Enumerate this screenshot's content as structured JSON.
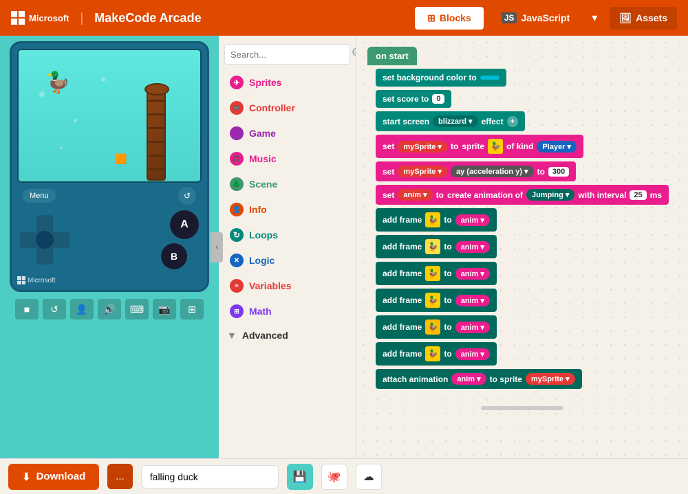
{
  "header": {
    "brand": "MakeCode Arcade",
    "ms_label": "Microsoft",
    "tab_blocks": "Blocks",
    "tab_javascript": "JavaScript",
    "tab_assets": "Assets"
  },
  "simulator": {
    "menu_label": "Menu",
    "ms_device_label": "Microsoft",
    "buttons": {
      "a": "A",
      "b": "B"
    }
  },
  "sim_toolbar": {
    "buttons": [
      "■",
      "↺",
      "👤",
      "🔊",
      "⌨",
      "📷",
      "⊞"
    ]
  },
  "categories": {
    "search_placeholder": "Search...",
    "items": [
      {
        "id": "sprites",
        "label": "Sprites",
        "color": "#e91e8c",
        "icon": "✈"
      },
      {
        "id": "controller",
        "label": "Controller",
        "color": "#e53935",
        "icon": "🎮"
      },
      {
        "id": "game",
        "label": "Game",
        "color": "#9c27b0",
        "icon": "⬤"
      },
      {
        "id": "music",
        "label": "Music",
        "color": "#e91e8c",
        "icon": "🎧"
      },
      {
        "id": "scene",
        "label": "Scene",
        "color": "#3d9970",
        "icon": "🌲"
      },
      {
        "id": "info",
        "label": "Info",
        "color": "#e04a00",
        "icon": "👤"
      },
      {
        "id": "loops",
        "label": "Loops",
        "color": "#00897b",
        "icon": "↻"
      },
      {
        "id": "logic",
        "label": "Logic",
        "color": "#1565c0",
        "icon": "✕"
      },
      {
        "id": "variables",
        "label": "Variables",
        "color": "#e53935",
        "icon": "≡"
      },
      {
        "id": "math",
        "label": "Math",
        "color": "#7c3aed",
        "icon": "⊞"
      },
      {
        "id": "advanced",
        "label": "Advanced",
        "color": "#555",
        "icon": "▼"
      }
    ]
  },
  "workspace": {
    "on_start_label": "on start",
    "blocks": [
      {
        "id": "set_bg",
        "text": "set background color to",
        "type": "teal",
        "has_color_pill": true
      },
      {
        "id": "set_score",
        "text": "set score to",
        "type": "teal",
        "value": "0"
      },
      {
        "id": "start_screen",
        "text": "start screen",
        "type": "teal",
        "extra": "blizzard",
        "extra2": "effect",
        "has_plus": true
      },
      {
        "id": "set_mysprite",
        "text": "set",
        "type": "pink",
        "pill1": "mySprite",
        "mid": "to",
        "mid2": "sprite",
        "has_sprite": true,
        "suffix": "of kind",
        "pill2": "Player"
      },
      {
        "id": "set_ay",
        "text": "set",
        "type": "pink",
        "pill1": "mySprite",
        "mid": "ay (acceleration y)",
        "mid2": "to",
        "value": "300"
      },
      {
        "id": "set_anim",
        "text": "set",
        "type": "pink",
        "pill1": "anim",
        "mid": "to",
        "mid2": "create animation of",
        "pill2": "Jumping",
        "suffix": "with interval",
        "value": "25",
        "suffix2": "ms"
      },
      {
        "id": "add_frame1",
        "text": "add frame",
        "type": "dark-teal",
        "has_sprite": true,
        "mid": "to",
        "pill": "anim"
      },
      {
        "id": "add_frame2",
        "text": "add frame",
        "type": "dark-teal",
        "has_sprite": true,
        "mid": "to",
        "pill": "anim"
      },
      {
        "id": "add_frame3",
        "text": "add frame",
        "type": "dark-teal",
        "has_sprite": true,
        "mid": "to",
        "pill": "anim"
      },
      {
        "id": "add_frame4",
        "text": "add frame",
        "type": "dark-teal",
        "has_sprite": true,
        "mid": "to",
        "pill": "anim"
      },
      {
        "id": "add_frame5",
        "text": "add frame",
        "type": "dark-teal",
        "has_sprite": true,
        "mid": "to",
        "pill": "anim"
      },
      {
        "id": "add_frame6",
        "text": "add frame",
        "type": "dark-teal",
        "has_sprite": true,
        "mid": "to",
        "pill": "anim"
      },
      {
        "id": "attach_anim",
        "text": "attach animation",
        "type": "dark-teal",
        "pill1": "anim",
        "mid": "to sprite",
        "pill2": "mySprite"
      }
    ]
  },
  "footer": {
    "download_label": "Download",
    "more_label": "...",
    "project_name": "falling duck",
    "save_icon": "💾",
    "github_icon": "🐙",
    "cloud_icon": "☁"
  }
}
